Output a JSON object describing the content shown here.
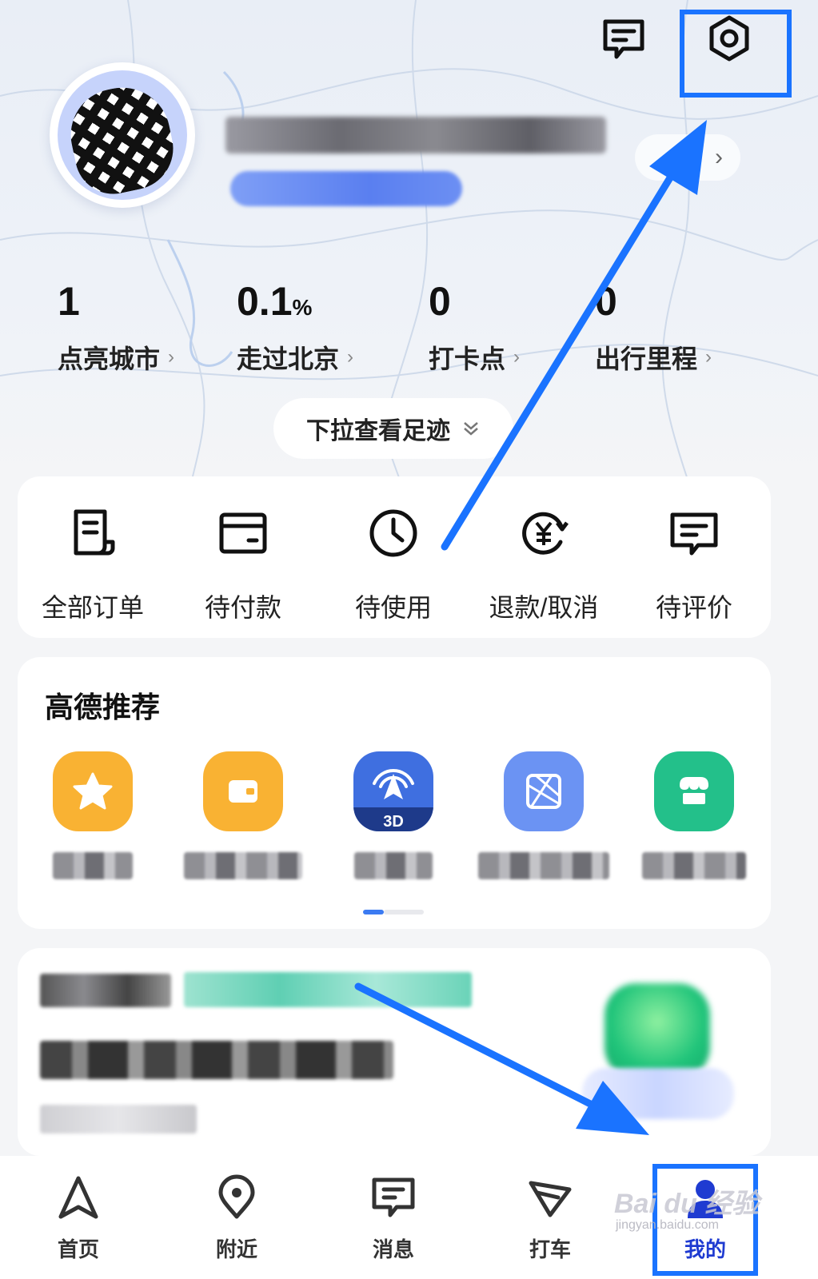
{
  "profile": {
    "username": "",
    "badge": ""
  },
  "stats": [
    {
      "value": "1",
      "unit": "",
      "label": "点亮城市"
    },
    {
      "value": "0.1",
      "unit": "%",
      "label": "走过北京"
    },
    {
      "value": "0",
      "unit": "",
      "label": "打卡点"
    },
    {
      "value": "0",
      "unit": "",
      "label": "出行里程"
    }
  ],
  "footprint": {
    "label": "下拉查看足迹"
  },
  "orders": [
    {
      "label": "全部订单",
      "icon": "order-list-icon"
    },
    {
      "label": "待付款",
      "icon": "wallet-card-icon"
    },
    {
      "label": "待使用",
      "icon": "clock-icon"
    },
    {
      "label": "退款/取消",
      "icon": "refund-yen-icon"
    },
    {
      "label": "待评价",
      "icon": "review-message-icon"
    }
  ],
  "recommend": {
    "title": "高德推荐",
    "items": [
      {
        "icon": "favorites-star-icon",
        "color": "#f9b233"
      },
      {
        "icon": "wallet-icon",
        "color": "#f9b233"
      },
      {
        "icon": "navigation-3d-icon",
        "color": "#3f6fe0",
        "badge": "3D"
      },
      {
        "icon": "map-grid-icon",
        "color": "#6b93f3"
      },
      {
        "icon": "store-icon",
        "color": "#23c08a"
      }
    ]
  },
  "nav": [
    {
      "label": "首页",
      "icon": "home-arrow-icon"
    },
    {
      "label": "附近",
      "icon": "location-pin-icon"
    },
    {
      "label": "消息",
      "icon": "message-icon"
    },
    {
      "label": "打车",
      "icon": "taxi-icon"
    },
    {
      "label": "我的",
      "icon": "profile-icon",
      "active": true
    }
  ],
  "watermark": {
    "brand": "Bai du 经验",
    "url": "jingyan.baidu.com"
  },
  "colors": {
    "accent": "#1a73ff",
    "nav_active": "#1f3bd1"
  }
}
